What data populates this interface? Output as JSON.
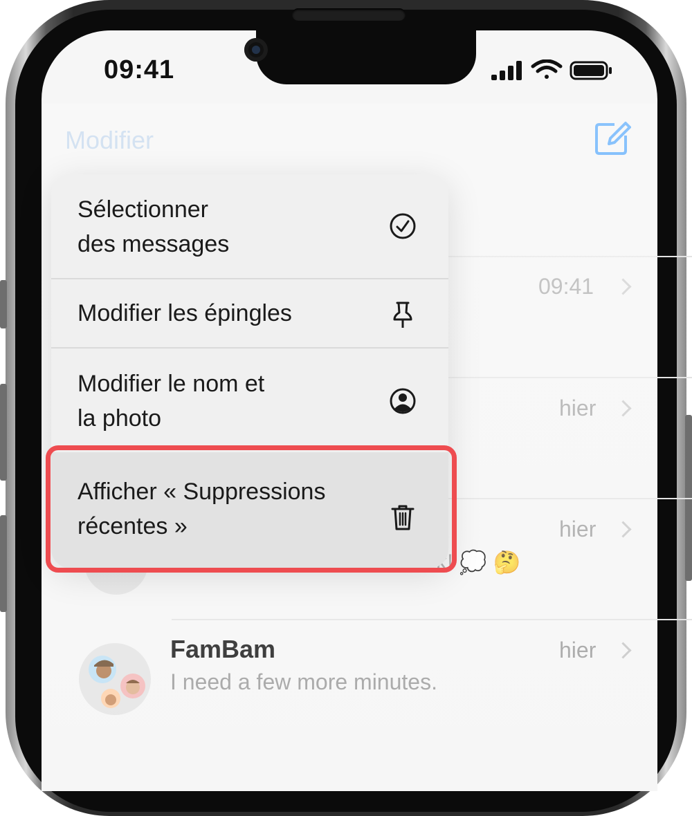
{
  "status_bar": {
    "time": "09:41"
  },
  "nav": {
    "edit_label": "Modifier"
  },
  "menu": {
    "items": [
      {
        "label": "Sélectionner\ndes messages",
        "icon": "checkmark-circle-icon"
      },
      {
        "label": "Modifier les épingles",
        "icon": "pin-icon"
      },
      {
        "label": "Modifier le nom et\nla photo",
        "icon": "person-circle-icon"
      },
      {
        "label": "Afficher « Suppressions\nrécentes »",
        "icon": "trash-icon"
      }
    ]
  },
  "conversations": [
    {
      "time": "09:41"
    },
    {
      "time": "hier"
    },
    {
      "time": "hier",
      "preview_fragment": "k! 💭 🤔"
    },
    {
      "name": "FamBam",
      "time": "hier",
      "preview": "I need a few more minutes."
    }
  ],
  "colors": {
    "accent": "#0a84ff",
    "highlight": "#ee4c50"
  }
}
